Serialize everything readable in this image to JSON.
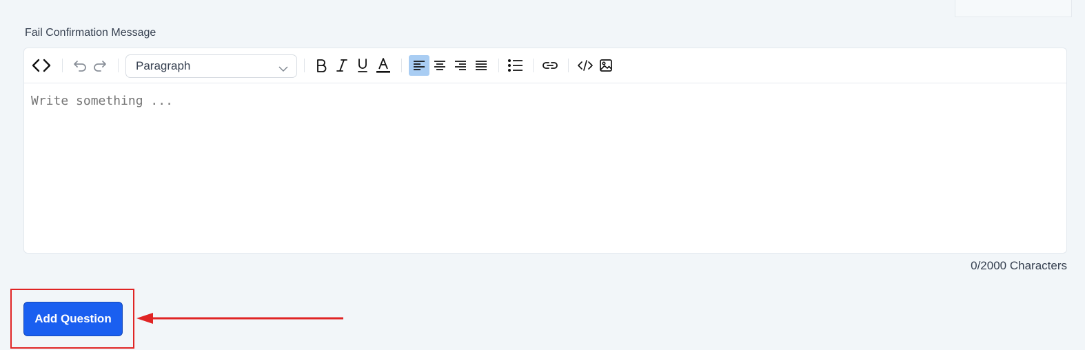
{
  "form": {
    "field_label": "Fail Confirmation Message",
    "editor": {
      "block_format": "Paragraph",
      "placeholder": "Write something ...",
      "alignment_active": "left",
      "toolbar_icons": [
        "code-view-icon",
        "undo-icon",
        "redo-icon",
        "bold-icon",
        "italic-icon",
        "underline-icon",
        "text-color-icon",
        "align-left-icon",
        "align-center-icon",
        "align-right-icon",
        "align-justify-icon",
        "bullet-list-icon",
        "link-icon",
        "code-icon",
        "image-icon"
      ]
    },
    "char_count": "0/2000 Characters",
    "submit_label": "Add Question"
  },
  "annotation": {
    "highlight_color": "#e02424",
    "arrow_color": "#e02424"
  },
  "colors": {
    "page_bg": "#f2f6f9",
    "button_bg": "#1a5ff0",
    "active_tool_bg": "#a9cdf3"
  }
}
